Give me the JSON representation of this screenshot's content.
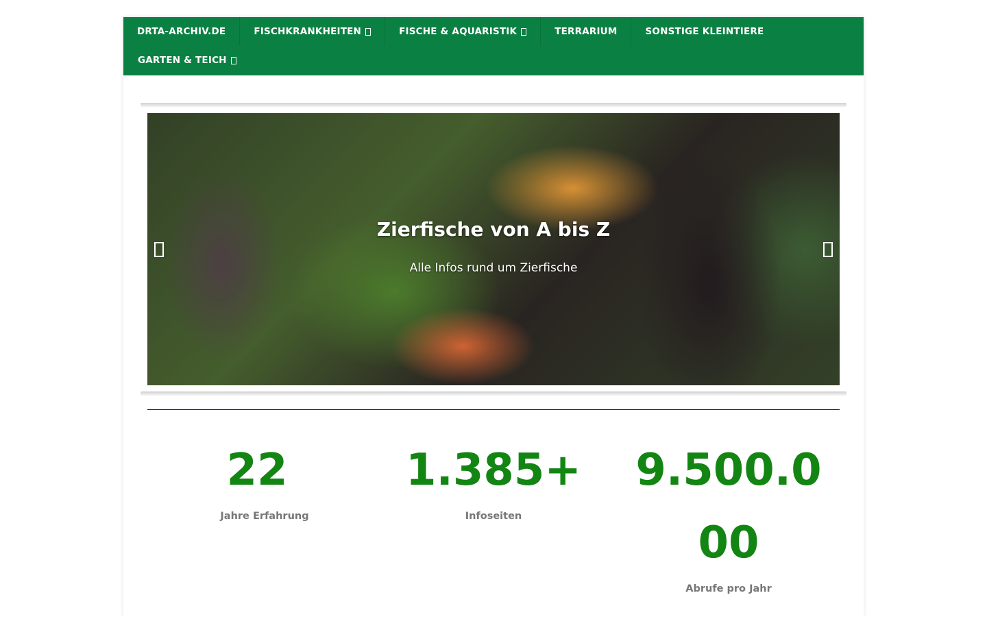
{
  "nav": {
    "items": [
      {
        "label": "DRTA-ARCHIV.DE",
        "has_submenu": false
      },
      {
        "label": "FISCHKRANKHEITEN",
        "has_submenu": true
      },
      {
        "label": "FISCHE & AQUARISTIK",
        "has_submenu": true
      },
      {
        "label": "TERRARIUM",
        "has_submenu": false
      },
      {
        "label": "SONSTIGE KLEINTIERE",
        "has_submenu": false
      },
      {
        "label": "GARTEN & TEICH",
        "has_submenu": true
      }
    ],
    "bg_color": "#0b8043"
  },
  "slider": {
    "title": "Zierfische von A bis Z",
    "subtitle": "Alle Infos rund um Zierfische",
    "prev_icon": "chevron-left-icon",
    "next_icon": "chevron-right-icon"
  },
  "stats": [
    {
      "number": "22",
      "label": "Jahre Erfahrung"
    },
    {
      "number": "1.385+",
      "label": "Infoseiten"
    },
    {
      "number_line1": "9.500.0",
      "number_line2": "00",
      "label": "Abrufe pro Jahr"
    }
  ],
  "colors": {
    "accent": "#138513",
    "label": "#777777"
  }
}
